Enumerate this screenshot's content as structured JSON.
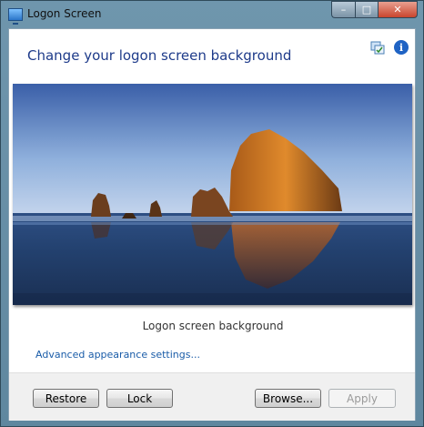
{
  "window": {
    "title": "Logon Screen",
    "controls": {
      "minimize": "–",
      "maximize": "□",
      "close": "✕"
    }
  },
  "header": {
    "title": "Change your logon screen background",
    "icons": [
      "change-icon",
      "info-icon"
    ],
    "info_glyph": "i"
  },
  "preview": {
    "caption": "Logon screen background"
  },
  "links": {
    "advanced": "Advanced appearance settings..."
  },
  "buttons": {
    "restore": "Restore",
    "lock": "Lock",
    "browse": "Browse...",
    "apply": "Apply"
  },
  "colors": {
    "heading": "#1e3b8a",
    "link": "#1a5ca8",
    "close_button": "#c9452d"
  }
}
